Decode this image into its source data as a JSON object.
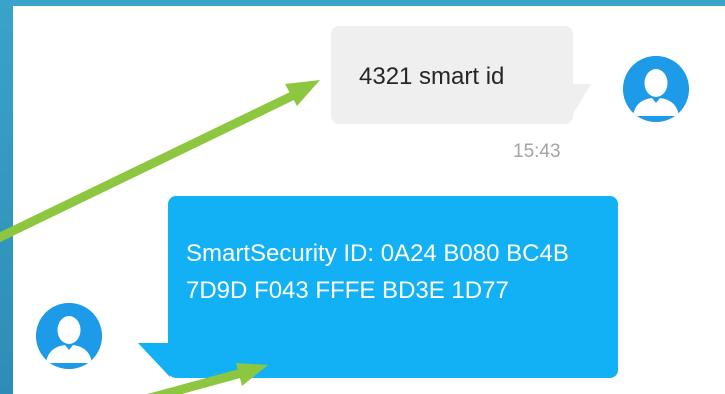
{
  "conversation": {
    "messages": [
      {
        "direction": "outgoing",
        "text": "4321 smart id",
        "time": "15:43"
      },
      {
        "direction": "incoming",
        "text": "SmartSecurity ID: 0A24 B080 BC4B 7D9D F043 FFFE BD3E 1D77"
      }
    ]
  },
  "colors": {
    "frame_background": "#39a3c9",
    "outgoing_bubble": "#efefef",
    "incoming_bubble": "#12b0f5",
    "avatar": "#1e9be8",
    "annotation_arrow": "#8dc63f"
  },
  "icons": {
    "avatar": "user-silhouette-icon",
    "annotation": "arrow-icon"
  }
}
